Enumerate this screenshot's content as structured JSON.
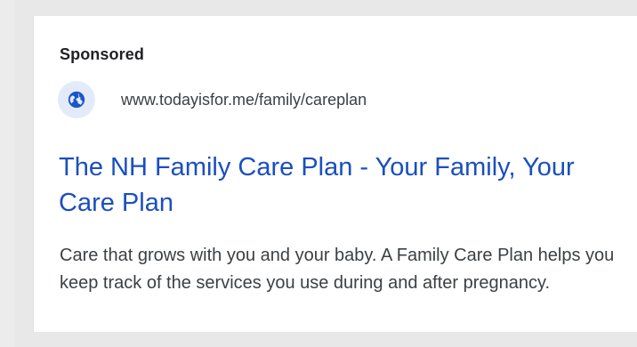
{
  "ad": {
    "label": "Sponsored",
    "favicon_icon": "globe-icon",
    "url": "www.todayisfor.me/family/careplan",
    "headline": "The NH Family Care Plan - Your Family, Your Care Plan",
    "description": "Care that grows with you and your baby. A Family Care Plan helps you keep track of the services you use during and after pregnancy."
  },
  "colors": {
    "headline": "#1a4fbf",
    "favicon_bg": "#e3ebfb",
    "globe": "#1a56c8",
    "page_bg": "#e8e8e8"
  }
}
